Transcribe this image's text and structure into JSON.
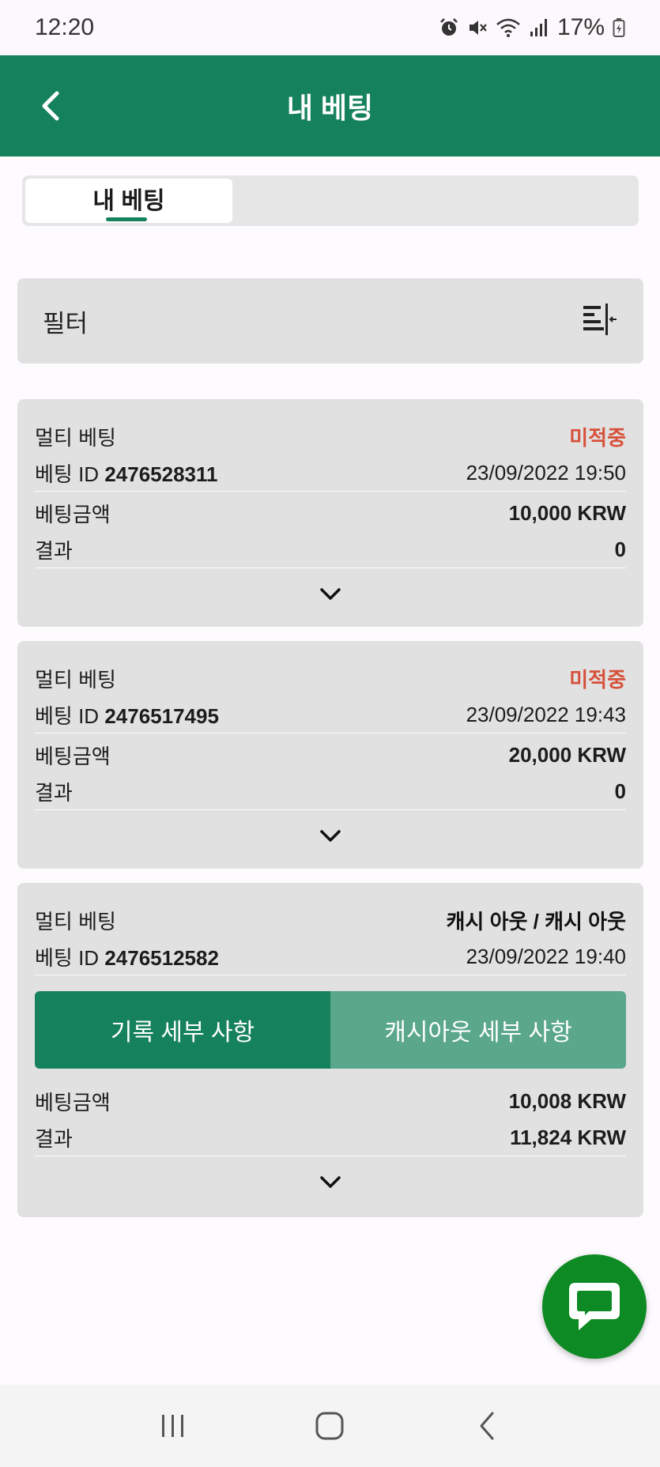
{
  "status_bar": {
    "time": "12:20",
    "battery": "17%",
    "icons": [
      "alarm-icon",
      "mute-icon",
      "wifi-icon",
      "signal-icon",
      "battery-charging-icon"
    ]
  },
  "header": {
    "title": "내 베팅",
    "back_icon": "chevron-left-icon"
  },
  "tabs": [
    {
      "label": "내 베팅",
      "active": true
    }
  ],
  "filter": {
    "label": "필터",
    "icon": "filter-collapse-icon"
  },
  "bets": [
    {
      "type": "멀티 베팅",
      "status": "미적중",
      "id_label": "베팅 ID",
      "id": "2476528311",
      "datetime": "23/09/2022 19:50",
      "amount_label": "베팅금액",
      "amount": "10,000 KRW",
      "result_label": "결과",
      "result": "0"
    },
    {
      "type": "멀티 베팅",
      "status": "미적중",
      "id_label": "베팅 ID",
      "id": "2476517495",
      "datetime": "23/09/2022 19:43",
      "amount_label": "베팅금액",
      "amount": "20,000 KRW",
      "result_label": "결과",
      "result": "0"
    },
    {
      "type": "멀티 베팅",
      "status": "캐시 아웃 / 캐시 아웃",
      "id_label": "베팅 ID",
      "id": "2476512582",
      "datetime": "23/09/2022 19:40",
      "history_button": "기록 세부 사항",
      "cashout_button": "캐시아웃 세부 사항",
      "amount_label": "베팅금액",
      "amount": "10,008 KRW",
      "result_label": "결과",
      "result": "11,824 KRW"
    }
  ],
  "colors": {
    "brand_green": "#16825d",
    "status_lost": "#d6513b",
    "fab_green": "#0d8a23",
    "secondary_green": "#5aa78b"
  }
}
